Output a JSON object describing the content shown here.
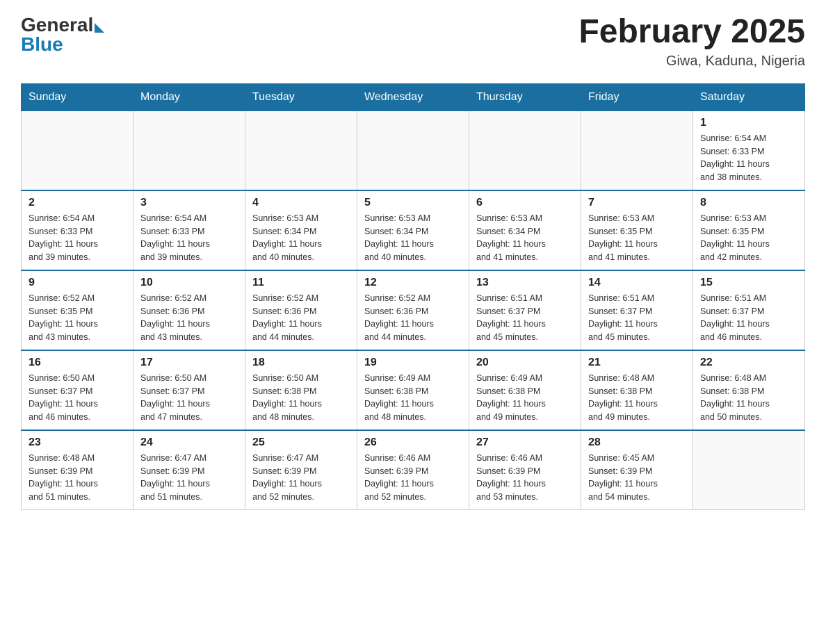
{
  "header": {
    "logo": {
      "general": "General",
      "blue": "Blue",
      "arrow_color": "#1a7ab5"
    },
    "title": "February 2025",
    "location": "Giwa, Kaduna, Nigeria"
  },
  "weekdays": [
    "Sunday",
    "Monday",
    "Tuesday",
    "Wednesday",
    "Thursday",
    "Friday",
    "Saturday"
  ],
  "weeks": [
    [
      {
        "day": "",
        "info": ""
      },
      {
        "day": "",
        "info": ""
      },
      {
        "day": "",
        "info": ""
      },
      {
        "day": "",
        "info": ""
      },
      {
        "day": "",
        "info": ""
      },
      {
        "day": "",
        "info": ""
      },
      {
        "day": "1",
        "info": "Sunrise: 6:54 AM\nSunset: 6:33 PM\nDaylight: 11 hours\nand 38 minutes."
      }
    ],
    [
      {
        "day": "2",
        "info": "Sunrise: 6:54 AM\nSunset: 6:33 PM\nDaylight: 11 hours\nand 39 minutes."
      },
      {
        "day": "3",
        "info": "Sunrise: 6:54 AM\nSunset: 6:33 PM\nDaylight: 11 hours\nand 39 minutes."
      },
      {
        "day": "4",
        "info": "Sunrise: 6:53 AM\nSunset: 6:34 PM\nDaylight: 11 hours\nand 40 minutes."
      },
      {
        "day": "5",
        "info": "Sunrise: 6:53 AM\nSunset: 6:34 PM\nDaylight: 11 hours\nand 40 minutes."
      },
      {
        "day": "6",
        "info": "Sunrise: 6:53 AM\nSunset: 6:34 PM\nDaylight: 11 hours\nand 41 minutes."
      },
      {
        "day": "7",
        "info": "Sunrise: 6:53 AM\nSunset: 6:35 PM\nDaylight: 11 hours\nand 41 minutes."
      },
      {
        "day": "8",
        "info": "Sunrise: 6:53 AM\nSunset: 6:35 PM\nDaylight: 11 hours\nand 42 minutes."
      }
    ],
    [
      {
        "day": "9",
        "info": "Sunrise: 6:52 AM\nSunset: 6:35 PM\nDaylight: 11 hours\nand 43 minutes."
      },
      {
        "day": "10",
        "info": "Sunrise: 6:52 AM\nSunset: 6:36 PM\nDaylight: 11 hours\nand 43 minutes."
      },
      {
        "day": "11",
        "info": "Sunrise: 6:52 AM\nSunset: 6:36 PM\nDaylight: 11 hours\nand 44 minutes."
      },
      {
        "day": "12",
        "info": "Sunrise: 6:52 AM\nSunset: 6:36 PM\nDaylight: 11 hours\nand 44 minutes."
      },
      {
        "day": "13",
        "info": "Sunrise: 6:51 AM\nSunset: 6:37 PM\nDaylight: 11 hours\nand 45 minutes."
      },
      {
        "day": "14",
        "info": "Sunrise: 6:51 AM\nSunset: 6:37 PM\nDaylight: 11 hours\nand 45 minutes."
      },
      {
        "day": "15",
        "info": "Sunrise: 6:51 AM\nSunset: 6:37 PM\nDaylight: 11 hours\nand 46 minutes."
      }
    ],
    [
      {
        "day": "16",
        "info": "Sunrise: 6:50 AM\nSunset: 6:37 PM\nDaylight: 11 hours\nand 46 minutes."
      },
      {
        "day": "17",
        "info": "Sunrise: 6:50 AM\nSunset: 6:37 PM\nDaylight: 11 hours\nand 47 minutes."
      },
      {
        "day": "18",
        "info": "Sunrise: 6:50 AM\nSunset: 6:38 PM\nDaylight: 11 hours\nand 48 minutes."
      },
      {
        "day": "19",
        "info": "Sunrise: 6:49 AM\nSunset: 6:38 PM\nDaylight: 11 hours\nand 48 minutes."
      },
      {
        "day": "20",
        "info": "Sunrise: 6:49 AM\nSunset: 6:38 PM\nDaylight: 11 hours\nand 49 minutes."
      },
      {
        "day": "21",
        "info": "Sunrise: 6:48 AM\nSunset: 6:38 PM\nDaylight: 11 hours\nand 49 minutes."
      },
      {
        "day": "22",
        "info": "Sunrise: 6:48 AM\nSunset: 6:38 PM\nDaylight: 11 hours\nand 50 minutes."
      }
    ],
    [
      {
        "day": "23",
        "info": "Sunrise: 6:48 AM\nSunset: 6:39 PM\nDaylight: 11 hours\nand 51 minutes."
      },
      {
        "day": "24",
        "info": "Sunrise: 6:47 AM\nSunset: 6:39 PM\nDaylight: 11 hours\nand 51 minutes."
      },
      {
        "day": "25",
        "info": "Sunrise: 6:47 AM\nSunset: 6:39 PM\nDaylight: 11 hours\nand 52 minutes."
      },
      {
        "day": "26",
        "info": "Sunrise: 6:46 AM\nSunset: 6:39 PM\nDaylight: 11 hours\nand 52 minutes."
      },
      {
        "day": "27",
        "info": "Sunrise: 6:46 AM\nSunset: 6:39 PM\nDaylight: 11 hours\nand 53 minutes."
      },
      {
        "day": "28",
        "info": "Sunrise: 6:45 AM\nSunset: 6:39 PM\nDaylight: 11 hours\nand 54 minutes."
      },
      {
        "day": "",
        "info": ""
      }
    ]
  ],
  "accent_color": "#1a6fa0"
}
